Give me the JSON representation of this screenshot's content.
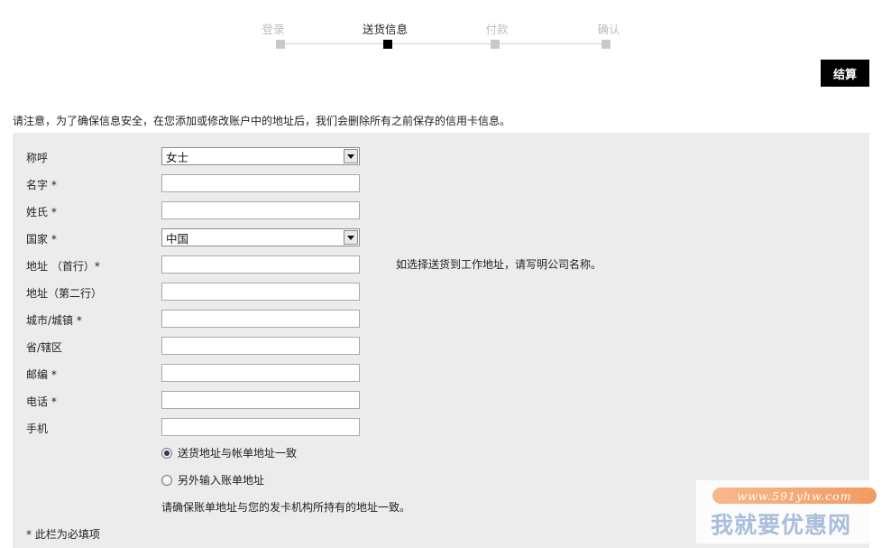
{
  "steps": [
    {
      "label": "登录",
      "active": false
    },
    {
      "label": "送货信息",
      "active": true
    },
    {
      "label": "付款",
      "active": false
    },
    {
      "label": "确认",
      "active": false
    }
  ],
  "checkout_button": "结算",
  "notice": "请注意，为了确保信息安全，在您添加或修改账户中的地址后，我们会删除所有之前保存的信用卡信息。",
  "form": {
    "title_label": "称呼",
    "title_value": "女士",
    "first_name_label": "名字 *",
    "last_name_label": "姓氏 *",
    "country_label": "国家 *",
    "country_value": "中国",
    "address1_label": "地址 （首行）*",
    "address2_label": "地址（第二行）",
    "city_label": "城市/城镇 *",
    "province_label": "省/辖区",
    "postcode_label": "邮编 *",
    "phone_label": "电话 *",
    "mobile_label": "手机",
    "address_hint": "如选择送货到工作地址，请写明公司名称。",
    "billing_same_label": "送货地址与帐单地址一致",
    "billing_other_label": "另外输入账单地址",
    "billing_note": "请确保账单地址与您的发卡机构所持有的地址一致。",
    "required_note": "* 此栏为必填项"
  },
  "watermark": {
    "url": "www.591yhw.com",
    "text": "我就要优惠网"
  }
}
